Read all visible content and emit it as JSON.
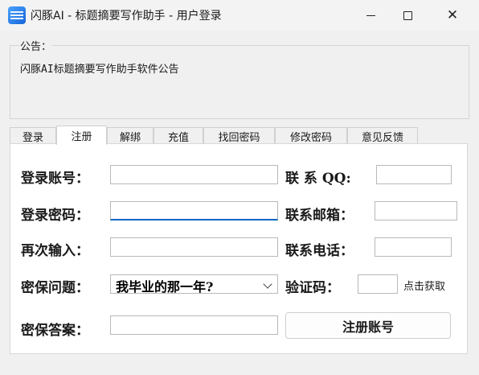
{
  "window": {
    "title": "闪豚AI - 标题摘要写作助手 - 用户登录",
    "min_glyph": "",
    "close_glyph": "✕"
  },
  "notice": {
    "legend": "公告：",
    "text": "闪豚AI标题摘要写作助手软件公告"
  },
  "tabs": [
    {
      "label": "登录"
    },
    {
      "label": "注册"
    },
    {
      "label": "解绑"
    },
    {
      "label": "充值"
    },
    {
      "label": "找回密码"
    },
    {
      "label": "修改密码"
    },
    {
      "label": "意见反馈"
    }
  ],
  "active_tab": 1,
  "form": {
    "account_label": "登录账号：",
    "password_label": "登录密码：",
    "confirm_label": "再次输入：",
    "question_label": "密保问题：",
    "question_value": "我毕业的那一年?",
    "answer_label": "密保答案：",
    "qq_label": "联  系  QQ:",
    "email_label": "联系邮箱：",
    "phone_label": "联系电话：",
    "captcha_label": "验证码：",
    "get_code": "点击获取",
    "register_button": "注册账号",
    "account_value": "",
    "password_value": "",
    "confirm_value": "",
    "answer_value": "",
    "qq_value": "",
    "email_value": "",
    "phone_value": "",
    "captcha_value": ""
  }
}
